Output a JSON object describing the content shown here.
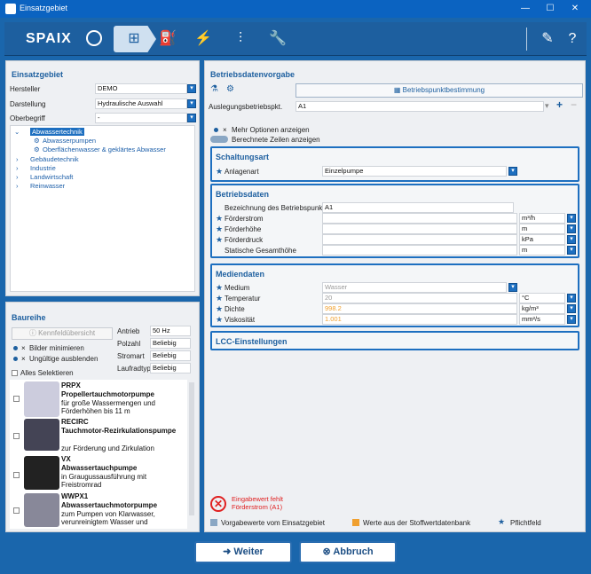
{
  "window": {
    "title": "Einsatzgebiet",
    "minimize": "—",
    "maximize": "☐",
    "close": "✕"
  },
  "toolbar": {
    "logo": "SPAIX",
    "icons": [
      "hierarchy-icon",
      "pump-icon",
      "plug-icon",
      "pipeline-icon",
      "wrench-icon",
      "settings-icon",
      "help-icon"
    ]
  },
  "einsatz": {
    "title": "Einsatzgebiet",
    "fields": [
      {
        "label": "Hersteller",
        "value": "DEMO"
      },
      {
        "label": "Darstellung",
        "value": "Hydraulische Auswahl"
      },
      {
        "label": "Oberbegriff",
        "value": "-"
      }
    ],
    "tree": {
      "selected": "Abwassertechnik",
      "children": [
        "Abwasserpumpen",
        "Oberflächenwasser & geklärtes Abwasser"
      ],
      "others": [
        "Gebäudetechnik",
        "Industrie",
        "Landwirtschaft",
        "Reinwasser"
      ]
    }
  },
  "baureihe": {
    "title": "Baureihe",
    "kennfeld": "Kennfeldübersicht",
    "opts": [
      "Bilder minimieren",
      "Ungültige ausblenden"
    ],
    "select_all": "Alles Selektieren",
    "props": [
      {
        "label": "Antrieb",
        "value": "50 Hz"
      },
      {
        "label": "Polzahl",
        "value": "Beliebig"
      },
      {
        "label": "Stromart",
        "value": "Beliebig"
      },
      {
        "label": "Laufradtyp",
        "value": "Beliebig"
      }
    ],
    "products": [
      {
        "code": "PRPX",
        "title": "Propellertauchmotorpumpe",
        "desc": "für große Wassermengen und Förderhöhen bis 11 m"
      },
      {
        "code": "RECIRC",
        "title": "Tauchmotor-Rezirkulationspumpe",
        "desc": "zur Förderung und Zirkulation"
      },
      {
        "code": "VX",
        "title": "Abwassertauchpumpe",
        "desc": "in Graugussausführung mit Freistromrad"
      },
      {
        "code": "WWPX1",
        "title": "Abwassertauchmotorpumpe",
        "desc": "zum Pumpen von Klarwasser, verunreinigtem Wasser und"
      }
    ]
  },
  "betrieb": {
    "title": "Betriebsdatenvorgabe",
    "bp_button": "Betriebspunktbestimmung",
    "ausleg_label": "Auslegungsbetriebspkt.",
    "ausleg_value": "A1",
    "mehr": "Mehr Optionen anzeigen",
    "berechnete": "Berechnete Zeilen anzeigen",
    "schaltung": {
      "title": "Schaltungsart",
      "label": "Anlagenart",
      "value": "Einzelpumpe"
    },
    "daten": {
      "title": "Betriebsdaten",
      "bez_label": "Bezeichnung des Betriebspunktes",
      "bez_value": "A1",
      "rows": [
        {
          "label": "Förderstrom",
          "unit": "m³/h"
        },
        {
          "label": "Förderhöhe",
          "unit": "m"
        },
        {
          "label": "Förderdruck",
          "unit": "kPa"
        },
        {
          "label": "Statische Gesamthöhe",
          "unit": "m"
        }
      ]
    },
    "medien": {
      "title": "Mediendaten",
      "rows": [
        {
          "label": "Medium",
          "value": "Wasser",
          "unit": ""
        },
        {
          "label": "Temperatur",
          "value": "20",
          "unit": "°C"
        },
        {
          "label": "Dichte",
          "value": "998.2",
          "unit": "kg/m³"
        },
        {
          "label": "Viskosität",
          "value": "1.001",
          "unit": "mm²/s"
        }
      ]
    },
    "lcc": {
      "title": "LCC-Einstellungen"
    }
  },
  "error": {
    "line1": "Eingabewert fehlt",
    "line2": "Förderstrom (A1)"
  },
  "legend": {
    "a": "Vorgabewerte vom Einsatzgebiet",
    "b": "Werte aus der Stoffwertdatenbank",
    "c": "Pflichtfeld"
  },
  "footer": {
    "weiter": "Weiter",
    "abbruch": "Abbruch"
  },
  "colors": {
    "brand": "#1d5f9f",
    "accent": "#f0a030",
    "error": "#e02020"
  }
}
